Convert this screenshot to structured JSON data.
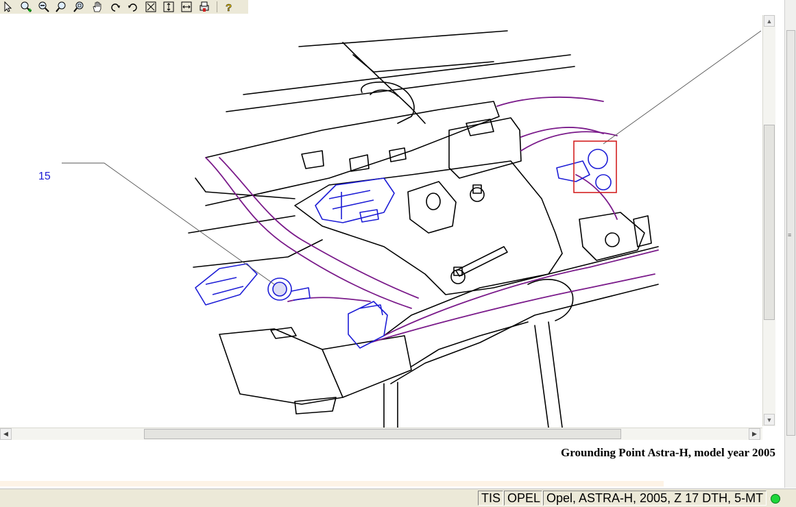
{
  "toolbar": {
    "buttons": [
      {
        "name": "select-pointer-icon"
      },
      {
        "name": "zoom-in-icon"
      },
      {
        "name": "zoom-out-icon"
      },
      {
        "name": "zoom-icon"
      },
      {
        "name": "zoom-window-icon"
      },
      {
        "name": "pan-hand-icon"
      },
      {
        "name": "rotate-left-icon"
      },
      {
        "name": "rotate-right-icon"
      },
      {
        "name": "fit-window-icon"
      },
      {
        "name": "fit-height-icon"
      },
      {
        "name": "fit-width-icon"
      },
      {
        "name": "print-icon"
      },
      {
        "name": "help-icon"
      }
    ]
  },
  "drawing": {
    "callout_label": "15",
    "highlight_color": "#d42020",
    "wire_color": "#7a1a8a",
    "component_color": "#1c1cd6"
  },
  "caption": "Grounding Point Astra-H, model year 2005",
  "statusbar": {
    "app": "TIS",
    "brand": "OPEL",
    "vehicle": "Opel, ASTRA-H, 2005, Z 17 DTH, 5-MT",
    "status_color": "#1ed63a"
  }
}
